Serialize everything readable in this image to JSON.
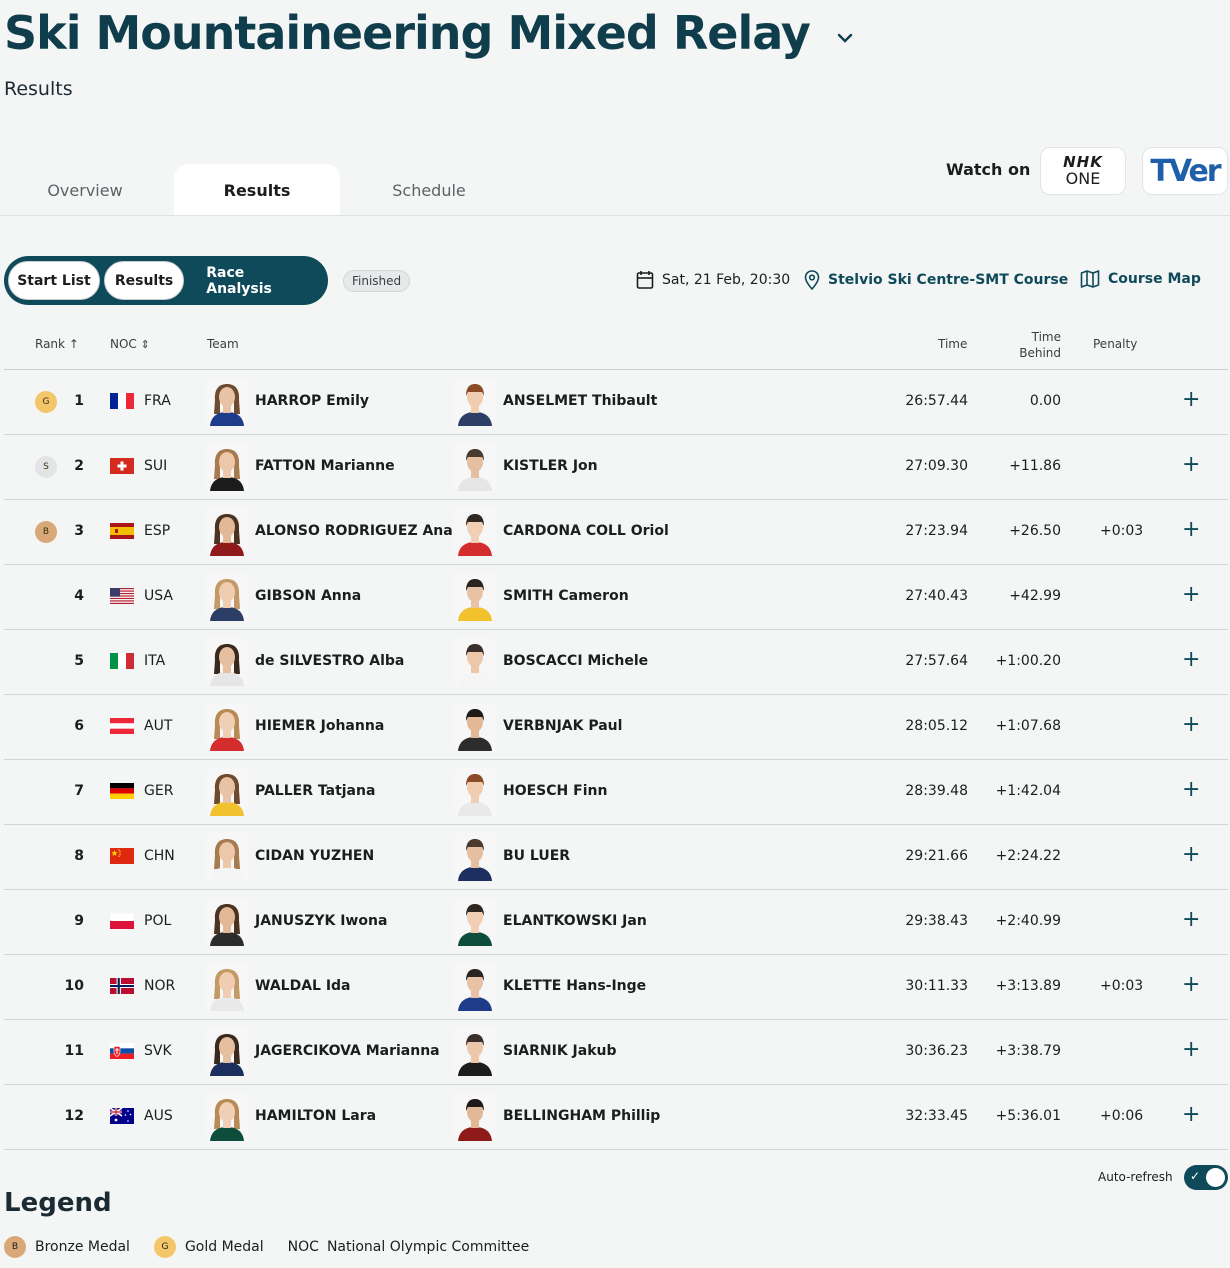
{
  "header": {
    "title": "Ski Mountaineering Mixed Relay",
    "subtitle": "Results"
  },
  "tabs": [
    {
      "label": "Overview",
      "active": false
    },
    {
      "label": "Results",
      "active": true
    },
    {
      "label": "Schedule",
      "active": false
    }
  ],
  "watch": {
    "label": "Watch on",
    "nhk_top": "NHK",
    "nhk_bottom": "ONE",
    "tver": "TVer"
  },
  "segments": {
    "start_list": "Start List",
    "results": "Results",
    "race_analysis": "Race Analysis",
    "status": "Finished"
  },
  "event_meta": {
    "date": "Sat, 21 Feb, 20:30",
    "venue": "Stelvio Ski Centre-SMT Course",
    "course_map": "Course Map"
  },
  "columns": {
    "rank": "Rank",
    "noc": "NOC",
    "team": "Team",
    "time": "Time",
    "time_behind_1": "Time",
    "time_behind_2": "Behind",
    "penalty": "Penalty"
  },
  "rows": [
    {
      "medal": "G",
      "rank": "1",
      "noc": "FRA",
      "a1": "HARROP Emily",
      "a2": "ANSELMET Thibault",
      "time": "26:57.44",
      "behind": "0.00",
      "penalty": ""
    },
    {
      "medal": "S",
      "rank": "2",
      "noc": "SUI",
      "a1": "FATTON Marianne",
      "a2": "KISTLER Jon",
      "time": "27:09.30",
      "behind": "+11.86",
      "penalty": ""
    },
    {
      "medal": "B",
      "rank": "3",
      "noc": "ESP",
      "a1": "ALONSO RODRIGUEZ Ana",
      "a2": "CARDONA COLL Oriol",
      "time": "27:23.94",
      "behind": "+26.50",
      "penalty": "+0:03"
    },
    {
      "medal": "",
      "rank": "4",
      "noc": "USA",
      "a1": "GIBSON Anna",
      "a2": "SMITH Cameron",
      "time": "27:40.43",
      "behind": "+42.99",
      "penalty": ""
    },
    {
      "medal": "",
      "rank": "5",
      "noc": "ITA",
      "a1": "de SILVESTRO Alba",
      "a2": "BOSCACCI Michele",
      "time": "27:57.64",
      "behind": "+1:00.20",
      "penalty": ""
    },
    {
      "medal": "",
      "rank": "6",
      "noc": "AUT",
      "a1": "HIEMER Johanna",
      "a2": "VERBNJAK Paul",
      "time": "28:05.12",
      "behind": "+1:07.68",
      "penalty": ""
    },
    {
      "medal": "",
      "rank": "7",
      "noc": "GER",
      "a1": "PALLER Tatjana",
      "a2": "HOESCH Finn",
      "time": "28:39.48",
      "behind": "+1:42.04",
      "penalty": ""
    },
    {
      "medal": "",
      "rank": "8",
      "noc": "CHN",
      "a1": "CIDAN YUZHEN",
      "a2": "BU LUER",
      "time": "29:21.66",
      "behind": "+2:24.22",
      "penalty": ""
    },
    {
      "medal": "",
      "rank": "9",
      "noc": "POL",
      "a1": "JANUSZYK Iwona",
      "a2": "ELANTKOWSKI Jan",
      "time": "29:38.43",
      "behind": "+2:40.99",
      "penalty": ""
    },
    {
      "medal": "",
      "rank": "10",
      "noc": "NOR",
      "a1": "WALDAL Ida",
      "a2": "KLETTE Hans-Inge",
      "time": "30:11.33",
      "behind": "+3:13.89",
      "penalty": "+0:03"
    },
    {
      "medal": "",
      "rank": "11",
      "noc": "SVK",
      "a1": "JAGERCIKOVA Marianna",
      "a2": "SIARNIK Jakub",
      "time": "30:36.23",
      "behind": "+3:38.79",
      "penalty": ""
    },
    {
      "medal": "",
      "rank": "12",
      "noc": "AUS",
      "a1": "HAMILTON Lara",
      "a2": "BELLINGHAM Phillip",
      "time": "32:33.45",
      "behind": "+5:36.01",
      "penalty": "+0:06"
    }
  ],
  "autorefresh": {
    "label": "Auto-refresh",
    "on": true
  },
  "legend": {
    "title": "Legend",
    "bronze_abbr": "B",
    "bronze": "Bronze Medal",
    "gold_abbr": "G",
    "gold": "Gold Medal",
    "noc_abbr": "NOC",
    "noc": "National Olympic Committee"
  },
  "colors": {
    "primary": "#0f4a5a",
    "gold": "#f3c66a",
    "silver": "#e3e4e5",
    "bronze": "#d9a878"
  }
}
